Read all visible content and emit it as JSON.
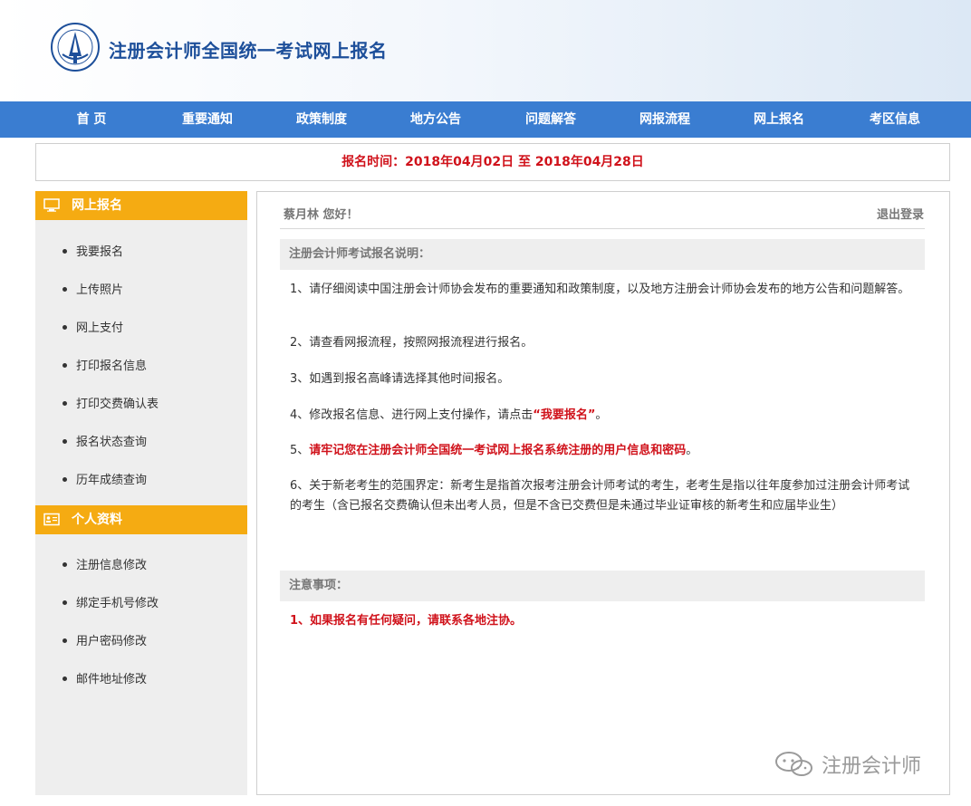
{
  "header": {
    "title": "注册会计师全国统一考试网上报名"
  },
  "nav": {
    "items": [
      "首 页",
      "重要通知",
      "政策制度",
      "地方公告",
      "问题解答",
      "网报流程",
      "网上报名",
      "考区信息"
    ]
  },
  "banner": {
    "text": "报名时间：2018年04月02日 至 2018年04月28日"
  },
  "sidebar": {
    "section1": {
      "title": "网上报名",
      "icon": "monitor-icon",
      "items": [
        "我要报名",
        "上传照片",
        "网上支付",
        "打印报名信息",
        "打印交费确认表",
        "报名状态查询",
        "历年成绩查询"
      ]
    },
    "section2": {
      "title": "个人资料",
      "icon": "id-card-icon",
      "items": [
        "注册信息修改",
        "绑定手机号修改",
        "用户密码修改",
        "邮件地址修改"
      ]
    }
  },
  "main": {
    "greeting": "蔡月林 您好！",
    "logout": "退出登录",
    "instructions_title": "注册会计师考试报名说明：",
    "p1": "1、请仔细阅读中国注册会计师协会发布的重要通知和政策制度，以及地方注册会计师协会发布的地方公告和问题解答。",
    "p2": "2、请查看网报流程，按照网报流程进行报名。",
    "p3": "3、如遇到报名高峰请选择其他时间报名。",
    "p4_prefix": "4、修改报名信息、进行网上支付操作，请点击",
    "p4_link": "“我要报名”",
    "p4_suffix": "。",
    "p5_prefix": "5、",
    "p5_red": "请牢记您在注册会计师全国统一考试网上报名系统注册的用户信息和密码",
    "p5_suffix": "。",
    "p6": "6、关于新老考生的范围界定：新考生是指首次报考注册会计师考试的考生，老考生是指以往年度参加过注册会计师考试的考生（含已报名交费确认但未出考人员，但是不含已交费但是未通过毕业证审核的新考生和应届毕业生）",
    "notes_title": "注意事项：",
    "note1": "1、如果报名有任何疑问，请联系各地注协。"
  },
  "watermark": {
    "text": "注册会计师",
    "icon": "wechat-icon"
  },
  "colors": {
    "nav": "#3a7dd1",
    "accent": "#f5ab12",
    "alert": "#d0121b",
    "title": "#1d4f9a"
  }
}
